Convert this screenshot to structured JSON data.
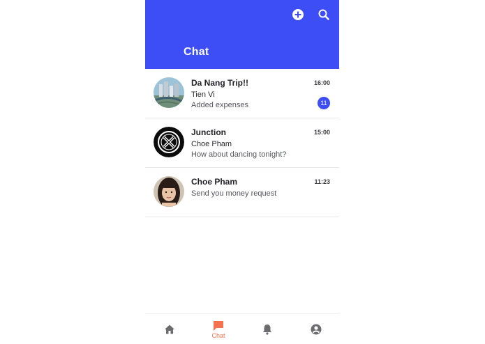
{
  "header": {
    "title": "Chat",
    "add_icon": "plus-circle-icon",
    "search_icon": "search-icon",
    "color": "#3d4ef7"
  },
  "chats": [
    {
      "name": "Da Nang Trip!!",
      "line2": "Tien Vi",
      "line3": "Added expenses",
      "time": "16:00",
      "badge": "11"
    },
    {
      "name": "Junction",
      "line2": "Choe Pham",
      "line3": "How about dancing tonight?",
      "time": "15:00"
    },
    {
      "name": "Choe Pham",
      "line2": "Send you money request",
      "time": "11:23"
    }
  ],
  "nav": {
    "active_color": "#f4734f",
    "inactive_color": "#6b6b70",
    "items": [
      {
        "icon": "home-icon"
      },
      {
        "icon": "chat-icon",
        "label": "Chat",
        "active": true
      },
      {
        "icon": "bell-icon"
      },
      {
        "icon": "profile-icon"
      }
    ]
  }
}
